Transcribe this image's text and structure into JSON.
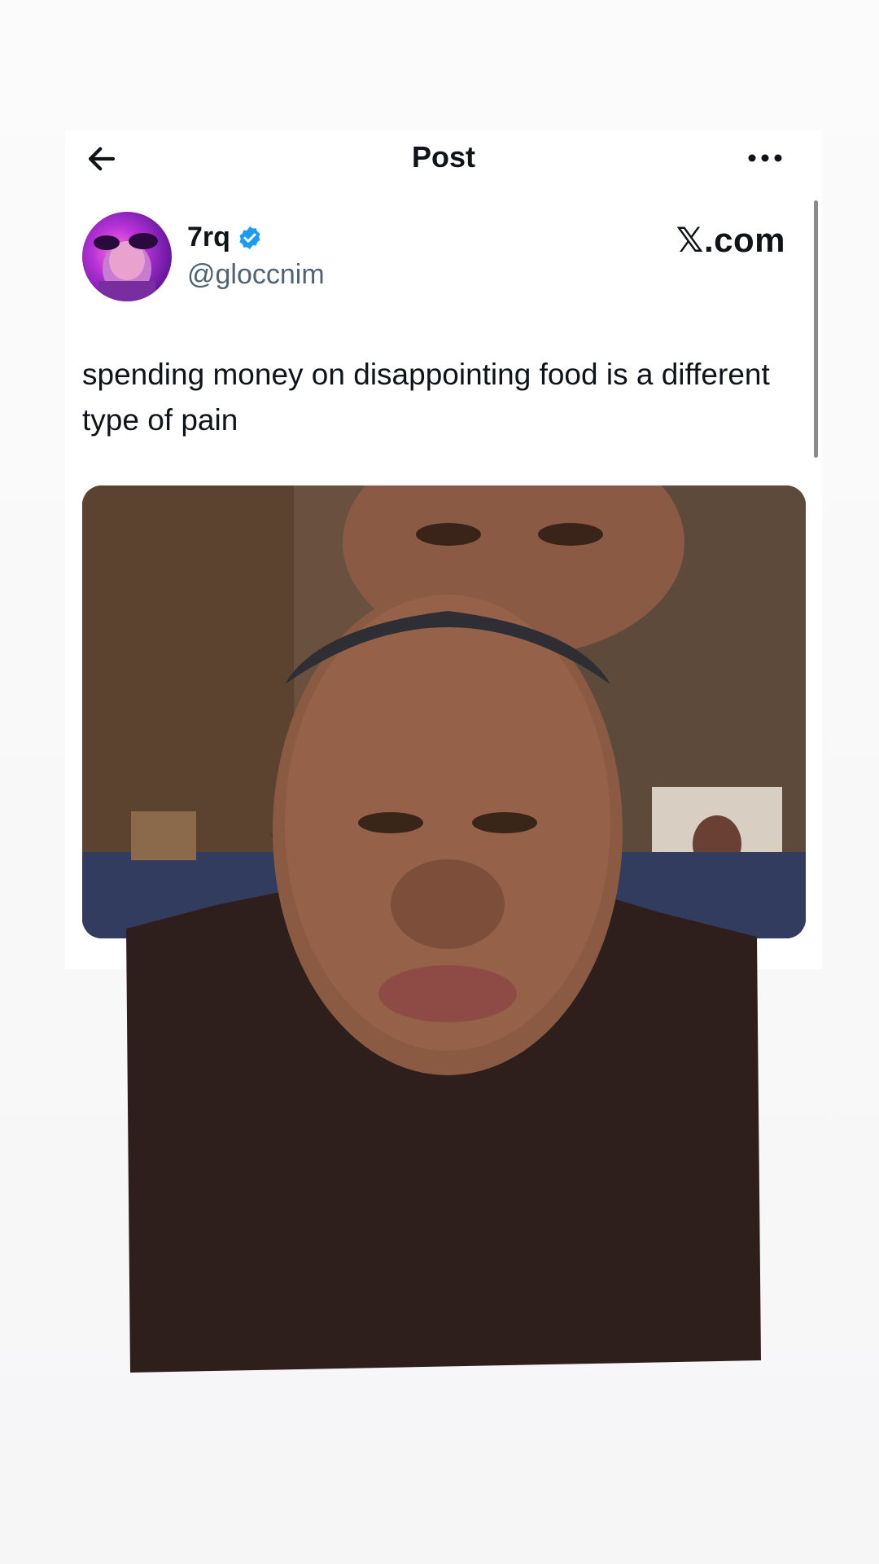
{
  "header": {
    "title": "Post",
    "back_icon": "arrow-left-icon",
    "more_icon": "more-horizontal-icon"
  },
  "post": {
    "author": {
      "name": "7rq",
      "handle": "@gloccnim",
      "verified": true,
      "verified_color": "#1d9bf0"
    },
    "brand": "𝕏.com",
    "text": "spending money on disappointing food is a different type of pain"
  },
  "colors": {
    "text_primary": "#0f1419",
    "text_secondary": "#536471",
    "background": "#ffffff"
  }
}
